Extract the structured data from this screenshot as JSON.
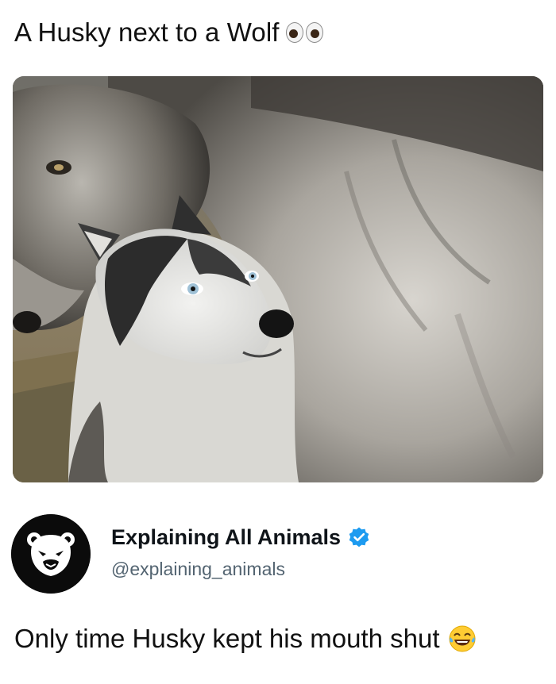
{
  "post": {
    "top_caption": "A Husky next to a Wolf",
    "top_caption_emoji": "eyes-emoji",
    "bottom_caption": "Only time Husky kept his mouth shut",
    "bottom_caption_emoji": "tears-of-joy-emoji"
  },
  "tweet_card": {
    "display_name": "Explaining All Animals",
    "handle": "@explaining_animals",
    "avatar_icon": "bear-face-icon",
    "verified_icon": "verified-badge-icon",
    "verified_color": "#1d9bf0"
  },
  "colors": {
    "text": "#111111",
    "handle_gray": "#536471",
    "avatar_bg": "#0b0b0b"
  }
}
